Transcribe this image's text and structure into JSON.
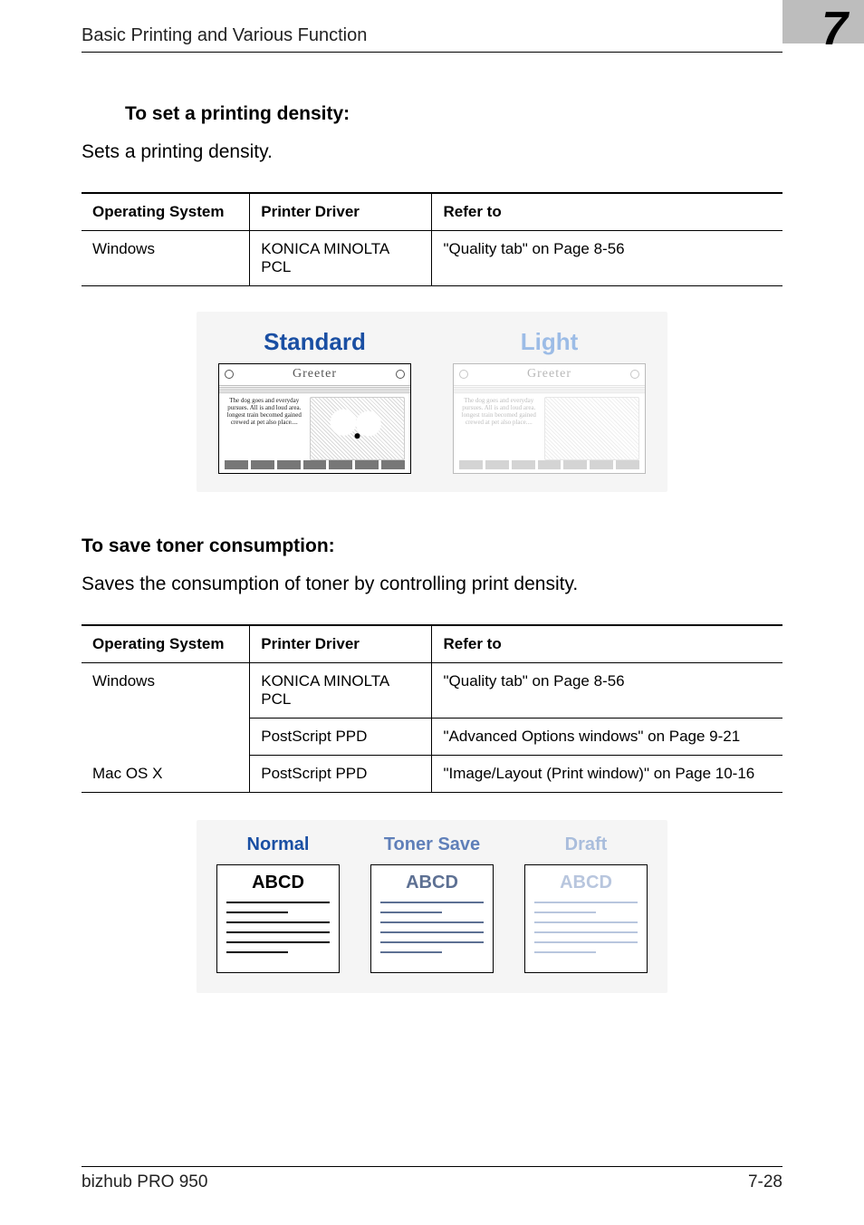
{
  "header": {
    "section_title": "Basic Printing and Various Function",
    "chapter_number": "7"
  },
  "section1": {
    "heading": "To set a printing density:",
    "body": "Sets a printing density.",
    "table": {
      "headers": {
        "os": "Operating System",
        "driver": "Printer Driver",
        "refer": "Refer to"
      },
      "rows": [
        {
          "os": "Windows",
          "driver": "KONICA MINOLTA PCL",
          "refer": "\"Quality tab\" on Page 8-56"
        }
      ]
    },
    "illustration": {
      "standard_label": "Standard",
      "light_label": "Light",
      "greeter_word": "Greeter",
      "fake_text": "The dog goes\nand everyday\npursues. All is\nand loud area.\nlongest train\nbecomed gained\ncrewed at pet\nalso place...."
    }
  },
  "section2": {
    "heading": "To save toner consumption:",
    "body": "Saves the consumption of toner by controlling print density.",
    "table": {
      "headers": {
        "os": "Operating System",
        "driver": "Printer Driver",
        "refer": "Refer to"
      },
      "rows": [
        {
          "os": "Windows",
          "driver": "KONICA MINOLTA PCL",
          "refer": "\"Quality tab\" on Page 8-56"
        },
        {
          "os": "",
          "driver": "PostScript PPD",
          "refer": "\"Advanced Options windows\" on Page 9-21"
        },
        {
          "os": "Mac OS X",
          "driver": "PostScript PPD",
          "refer": "\"Image/Layout (Print window)\" on Page 10-16"
        }
      ]
    },
    "illustration": {
      "normal_label": "Normal",
      "save_label": "Toner Save",
      "draft_label": "Draft",
      "sample_text": "ABCD"
    }
  },
  "footer": {
    "left": "bizhub PRO 950",
    "right": "7-28"
  }
}
